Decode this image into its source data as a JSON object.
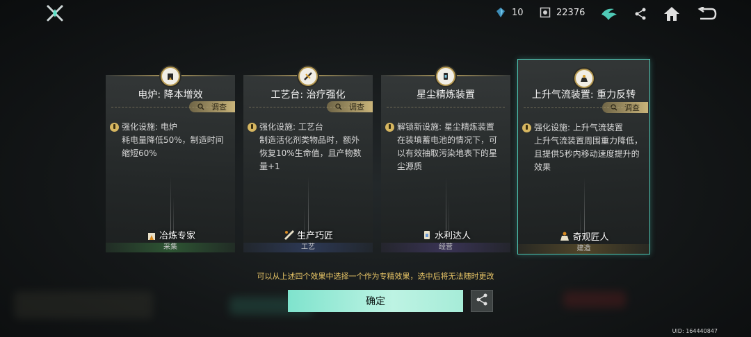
{
  "top_bar": {
    "resource_1": "10",
    "resource_2": "22376",
    "icons": [
      "crossed-swords-icon",
      "crystal-icon",
      "coin-icon",
      "emblem-icon",
      "share-icon",
      "home-icon",
      "back-icon"
    ]
  },
  "cards": [
    {
      "title": "电炉: 降本增效",
      "inspect": "调查",
      "desc": "强化设施: 电炉\n耗电量降低50%，制造时间缩短60%",
      "role": "冶炼专家",
      "category": "采集",
      "category_color": "#2f5a35"
    },
    {
      "title": "工艺台: 治疗强化",
      "inspect": "调查",
      "desc": "强化设施: 工艺台\n制造活化剂类物品时，额外恢复10%生命值，且产物数量+1",
      "role": "生产巧匠",
      "category": "工艺",
      "category_color": "#2e3b5a"
    },
    {
      "title": "星尘精炼装置",
      "inspect": "调查",
      "desc": "解锁新设施: 星尘精炼装置\n在装填蓄电池的情况下，可以有效抽取污染地表下的星尘源质",
      "role": "水利达人",
      "category": "经营",
      "category_color": "#3c355a"
    },
    {
      "title": "上升气流装置: 重力反转",
      "inspect": "调查",
      "desc": "强化设施: 上升气流装置\n上升气流装置周围重力降低，且提供5秒内移动速度提升的效果",
      "role": "奇观匠人",
      "category": "建造",
      "category_color": "#55492a",
      "selected": true
    }
  ],
  "notice": "可以从上述四个效果中选择一个作为专精效果，选中后将无法随时更改",
  "confirm_label": "确定",
  "uid": "UID: 164440847",
  "colors": {
    "accent": "#4fc9b6",
    "gold": "#c9b47a",
    "notice": "#e9c667"
  }
}
